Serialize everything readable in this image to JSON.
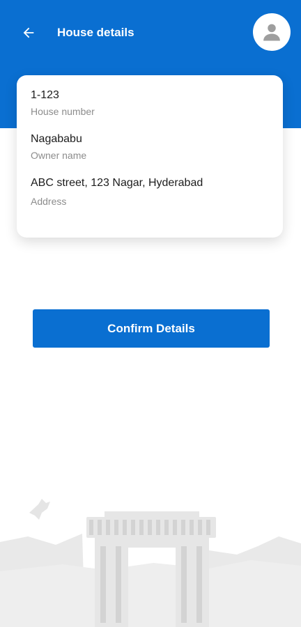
{
  "header": {
    "title": "House details",
    "back_icon": "arrow-left-icon",
    "avatar_icon": "user-icon",
    "color": "#0a6fd1"
  },
  "details": {
    "house_number": {
      "value": "1-123",
      "label": "House number"
    },
    "owner_name": {
      "value": "Nagababu",
      "label": "Owner name"
    },
    "address": {
      "value": "ABC street, 123 Nagar, Hyderabad",
      "label": "Address"
    }
  },
  "confirm_button": {
    "label": "Confirm Details"
  },
  "footer_illustration": "monument-silhouette"
}
